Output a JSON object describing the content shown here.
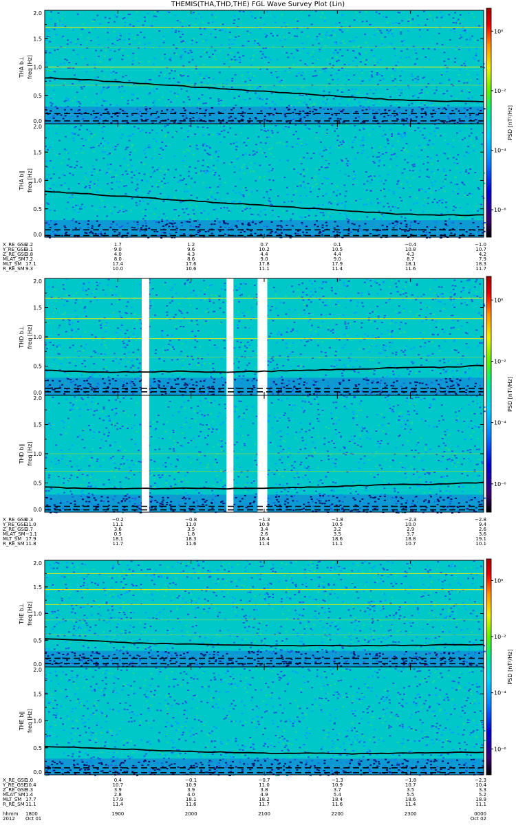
{
  "title": "THEMIS(THA,THD,THE) FGL Wave Survey Plot (Lin)",
  "colors": {
    "background": "#00c8c8",
    "speckle_low": "#1d60e0",
    "speckle_mid": "#00a0ff",
    "speckle_high": "#20d890",
    "band_dark": "#0a1870",
    "harmonic": "#c8e600",
    "harmonic_bright": "#f0f000",
    "gap": "#ffffff",
    "curve": "#000000"
  },
  "colorbar": {
    "label": "PSD [nT²/Hz]",
    "ticks": [
      "10⁰",
      "10⁻²",
      "10⁻⁴",
      "10⁻⁶"
    ],
    "stops": [
      "#000000",
      "#3a0070",
      "#0000c8",
      "#0078ff",
      "#00d0ff",
      "#00e8a0",
      "#60f000",
      "#f0f000",
      "#ff9000",
      "#e00000",
      "#a00000"
    ]
  },
  "yaxis": {
    "ticks": [
      "0.0",
      "0.5",
      "1.0",
      "1.5",
      "2.0"
    ],
    "label": "freq [Hz]"
  },
  "chart_data": [
    {
      "type": "heatmap",
      "probe": "THA",
      "component": "THA b⊥",
      "ylabel": "freq [Hz]",
      "ylim": [
        0,
        2.0
      ],
      "harmonics": [
        1.0,
        1.7
      ],
      "faint_harmonics": [
        0.68,
        1.35
      ],
      "curve": [
        [
          0,
          0.81
        ],
        [
          0.1,
          0.77
        ],
        [
          0.2,
          0.72
        ],
        [
          0.3,
          0.67
        ],
        [
          0.4,
          0.62
        ],
        [
          0.5,
          0.57
        ],
        [
          0.6,
          0.52
        ],
        [
          0.7,
          0.47
        ],
        [
          0.8,
          0.42
        ],
        [
          0.9,
          0.4
        ],
        [
          1.0,
          0.39
        ]
      ],
      "dashed": [
        0.05,
        0.18
      ],
      "gaps": []
    },
    {
      "type": "heatmap",
      "probe": "THA",
      "component": "THA b∥",
      "ylabel": "freq [Hz]",
      "ylim": [
        0,
        2.0
      ],
      "harmonics": [],
      "faint_harmonics": [],
      "curve": [
        [
          0,
          0.81
        ],
        [
          0.1,
          0.76
        ],
        [
          0.2,
          0.71
        ],
        [
          0.3,
          0.66
        ],
        [
          0.4,
          0.61
        ],
        [
          0.5,
          0.56
        ],
        [
          0.6,
          0.51
        ],
        [
          0.7,
          0.46
        ],
        [
          0.8,
          0.41
        ],
        [
          0.9,
          0.39
        ],
        [
          1.0,
          0.39
        ]
      ],
      "dashed": [
        0.03,
        0.13
      ],
      "gaps": []
    },
    {
      "type": "heatmap",
      "probe": "THD",
      "component": "THD b⊥",
      "ylabel": "freq [Hz]",
      "ylim": [
        0,
        2.0
      ],
      "harmonics": [
        0.97,
        1.31,
        1.66
      ],
      "faint_harmonics": [
        0.65
      ],
      "curve": [
        [
          0,
          0.43
        ],
        [
          0.1,
          0.4
        ],
        [
          0.2,
          0.4
        ],
        [
          0.3,
          0.41
        ],
        [
          0.4,
          0.4
        ],
        [
          0.5,
          0.41
        ],
        [
          0.6,
          0.43
        ],
        [
          0.7,
          0.45
        ],
        [
          0.8,
          0.47
        ],
        [
          0.9,
          0.48
        ],
        [
          1.0,
          0.51
        ]
      ],
      "dashed": [
        0.06,
        0.12
      ],
      "gaps": [
        [
          0.221,
          0.238
        ],
        [
          0.414,
          0.43
        ],
        [
          0.485,
          0.507
        ]
      ]
    },
    {
      "type": "heatmap",
      "probe": "THD",
      "component": "THD b∥",
      "ylabel": "freq [Hz]",
      "ylim": [
        0,
        2.0
      ],
      "harmonics": [],
      "faint_harmonics": [
        0.7,
        1.0
      ],
      "curve": [
        [
          0,
          0.43
        ],
        [
          0.1,
          0.4
        ],
        [
          0.2,
          0.4
        ],
        [
          0.3,
          0.41
        ],
        [
          0.4,
          0.4
        ],
        [
          0.5,
          0.41
        ],
        [
          0.6,
          0.43
        ],
        [
          0.7,
          0.45
        ],
        [
          0.8,
          0.47
        ],
        [
          0.9,
          0.48
        ],
        [
          1.0,
          0.51
        ]
      ],
      "dashed": [
        0.04,
        0.1
      ],
      "gaps": [
        [
          0.221,
          0.238
        ],
        [
          0.414,
          0.43
        ],
        [
          0.485,
          0.507
        ]
      ]
    },
    {
      "type": "heatmap",
      "probe": "THE",
      "component": "THE b⊥",
      "ylabel": "freq [Hz]",
      "ylim": [
        0,
        2.0
      ],
      "harmonics": [
        1.17,
        1.45,
        1.75
      ],
      "faint_harmonics": [
        0.88,
        0.6
      ],
      "curve": [
        [
          0,
          0.53
        ],
        [
          0.1,
          0.5
        ],
        [
          0.2,
          0.45
        ],
        [
          0.3,
          0.43
        ],
        [
          0.4,
          0.41
        ],
        [
          0.5,
          0.4
        ],
        [
          0.6,
          0.4
        ],
        [
          0.7,
          0.4
        ],
        [
          0.8,
          0.4
        ],
        [
          0.9,
          0.41
        ],
        [
          1.0,
          0.42
        ]
      ],
      "dashed": [
        0.06,
        0.16
      ],
      "gaps": []
    },
    {
      "type": "heatmap",
      "probe": "THE",
      "component": "THE b∥",
      "ylabel": "freq [Hz]",
      "ylim": [
        0,
        2.0
      ],
      "harmonics": [],
      "faint_harmonics": [],
      "curve": [
        [
          0,
          0.52
        ],
        [
          0.1,
          0.5
        ],
        [
          0.2,
          0.47
        ],
        [
          0.3,
          0.44
        ],
        [
          0.4,
          0.42
        ],
        [
          0.5,
          0.4
        ],
        [
          0.6,
          0.4
        ],
        [
          0.7,
          0.39
        ],
        [
          0.8,
          0.4
        ],
        [
          0.9,
          0.41
        ],
        [
          1.0,
          0.42
        ]
      ],
      "dashed": [
        0.04,
        0.13
      ],
      "gaps": []
    }
  ],
  "ephemeris": [
    {
      "rows": [
        {
          "label": "X_RE_GSE",
          "values": [
            "2.2",
            "1.7",
            "1.2",
            "0.7",
            "0.1",
            "−0.4",
            "−1.0"
          ]
        },
        {
          "label": "Y_RE_GSE",
          "values": [
            "9.1",
            "9.0",
            "9.6",
            "10.2",
            "10.5",
            "10.8",
            "10.7"
          ]
        },
        {
          "label": "Z_RE_GSE",
          "values": [
            "3.8",
            "4.0",
            "4.3",
            "4.4",
            "4.4",
            "4.3",
            "4.2"
          ]
        },
        {
          "label": "MLAT_SM",
          "values": [
            "7.2",
            "8.0",
            "8.6",
            "9.0",
            "9.0",
            "8.7",
            "7.9"
          ]
        },
        {
          "label": "MLT_SM",
          "values": [
            "17.1",
            "17.4",
            "17.6",
            "17.8",
            "17.9",
            "18.1",
            "18.3"
          ]
        },
        {
          "label": "R_RE_SM",
          "values": [
            "9.3",
            "10.0",
            "10.6",
            "11.1",
            "11.4",
            "11.6",
            "11.7"
          ]
        }
      ]
    },
    {
      "rows": [
        {
          "label": "X_RE_GSE",
          "values": [
            "0.3",
            "−0.2",
            "−0.8",
            "−1.3",
            "−1.8",
            "−2.3",
            "−2.8"
          ]
        },
        {
          "label": "Y_RE_GSE",
          "values": [
            "11.0",
            "11.1",
            "11.0",
            "10.9",
            "10.5",
            "10.0",
            "9.4"
          ]
        },
        {
          "label": "Z_RE_GSE",
          "values": [
            "3.7",
            "3.6",
            "3.5",
            "3.4",
            "3.2",
            "2.9",
            "2.6"
          ]
        },
        {
          "label": "MLAT_SM",
          "values": [
            "−1.1",
            "0.5",
            "1.8",
            "2.6",
            "3.5",
            "3.7",
            "3.6"
          ]
        },
        {
          "label": "MLT_SM",
          "values": [
            "17.9",
            "18.1",
            "18.3",
            "18.4",
            "18.6",
            "18.8",
            "19.1"
          ]
        },
        {
          "label": "R_RE_SM",
          "values": [
            "11.8",
            "11.7",
            "11.6",
            "11.4",
            "11.1",
            "10.7",
            "10.1"
          ]
        }
      ]
    },
    {
      "rows": [
        {
          "label": "X_RE_GSE",
          "values": [
            "1.0",
            "0.4",
            "−0.1",
            "−0.7",
            "−1.3",
            "−1.8",
            "−2.3"
          ]
        },
        {
          "label": "Y_RE_GSE",
          "values": [
            "10.4",
            "10.7",
            "10.9",
            "11.0",
            "10.9",
            "10.7",
            "10.4"
          ]
        },
        {
          "label": "Z_RE_GSE",
          "values": [
            "3.3",
            "3.9",
            "3.9",
            "3.8",
            "3.7",
            "3.5",
            "3.3"
          ]
        },
        {
          "label": "MLAT_SM",
          "values": [
            "1.4",
            "2.8",
            "4.0",
            "4.9",
            "5.4",
            "5.5",
            "5.2"
          ]
        },
        {
          "label": "MLT_SM",
          "values": [
            "17.7",
            "17.9",
            "18.1",
            "18.2",
            "18.4",
            "18.6",
            "18.9"
          ]
        },
        {
          "label": "R_RE_SM",
          "values": [
            "11.1",
            "11.4",
            "11.6",
            "11.7",
            "11.6",
            "11.4",
            "11.1"
          ]
        }
      ]
    }
  ],
  "time_axis": {
    "label": "hhmm",
    "values": [
      "1800",
      "1900",
      "2000",
      "2100",
      "2200",
      "2300",
      "0000"
    ],
    "date_label": "2012",
    "dates": [
      "Oct 01",
      "Oct 02"
    ]
  }
}
